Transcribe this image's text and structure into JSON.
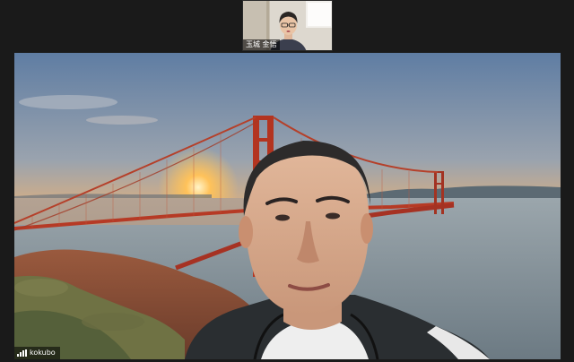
{
  "window": {
    "background": "#1a1a1a"
  },
  "thumbnail": {
    "participant_name": "玉城 金悟"
  },
  "main_video": {
    "participant_name": "kokubo",
    "signal_icon": "signal-strength-icon"
  }
}
